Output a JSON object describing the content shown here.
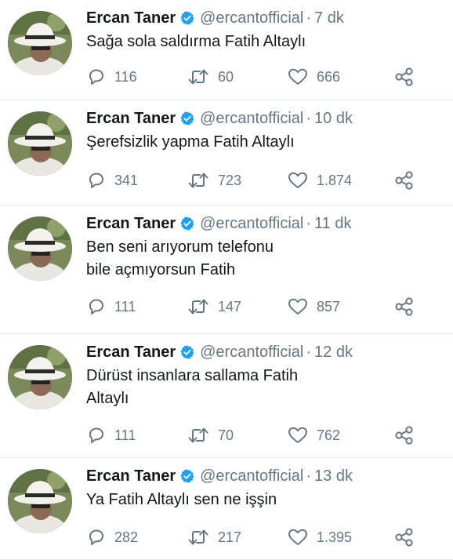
{
  "tweets": [
    {
      "name": "Ercan Taner",
      "handle": "@ercantofficial",
      "time": "7 dk",
      "lines": [
        "Sağa sola saldırma Fatih Altaylı"
      ],
      "replies": "116",
      "retweets": "60",
      "likes": "666"
    },
    {
      "name": "Ercan Taner",
      "handle": "@ercantofficial",
      "time": "10 dk",
      "lines": [
        "Şerefsizlik yapma  Fatih Altaylı"
      ],
      "replies": "341",
      "retweets": "723",
      "likes": "1.874"
    },
    {
      "name": "Ercan Taner",
      "handle": "@ercantofficial",
      "time": "11 dk",
      "lines": [
        "Ben seni arıyorum telefonu",
        "bile açmıyorsun Fatih"
      ],
      "replies": "111",
      "retweets": "147",
      "likes": "857"
    },
    {
      "name": "Ercan Taner",
      "handle": "@ercantofficial",
      "time": "12 dk",
      "lines": [
        "Dürüst insanlara sallama Fatih",
        "Altaylı"
      ],
      "replies": "111",
      "retweets": "70",
      "likes": "762"
    },
    {
      "name": "Ercan Taner",
      "handle": "@ercantofficial",
      "time": "13 dk",
      "lines": [
        "Ya Fatih  Altaylı sen ne işşin"
      ],
      "replies": "282",
      "retweets": "217",
      "likes": "1.395"
    }
  ],
  "separator": "·",
  "colors": {
    "verified": "#1da1f2",
    "muted": "#657786",
    "text": "#14171a",
    "divider": "#e1e8ed"
  },
  "icons": {
    "reply": "reply-icon",
    "retweet": "retweet-icon",
    "like": "like-icon",
    "share": "share-icon",
    "verified": "verified-badge-icon"
  }
}
